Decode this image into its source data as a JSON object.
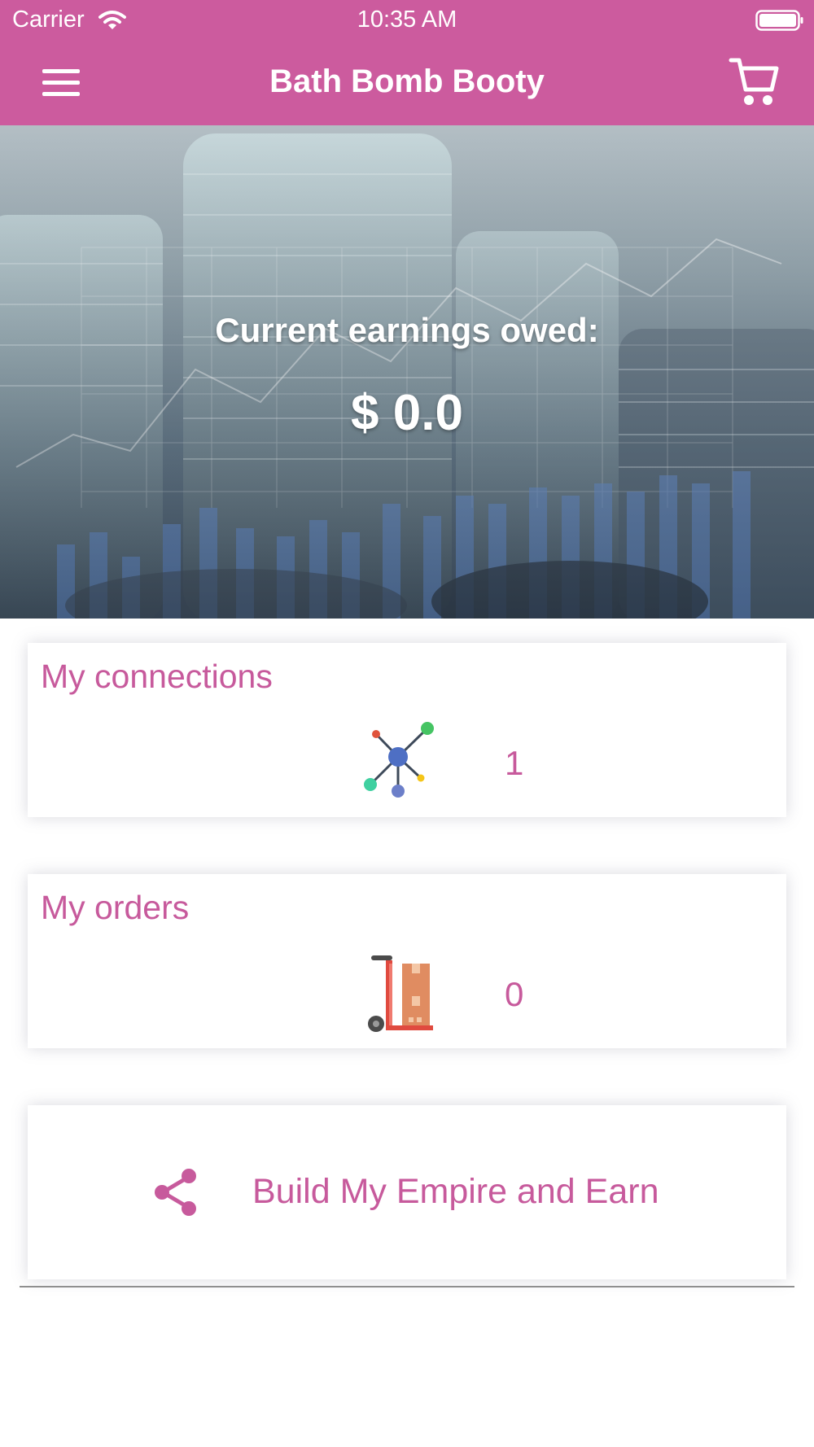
{
  "status_bar": {
    "carrier": "Carrier",
    "time": "10:35 AM"
  },
  "nav": {
    "title": "Bath Bomb Booty",
    "menu_icon": "hamburger-menu-icon",
    "cart_icon": "shopping-cart-icon"
  },
  "hero": {
    "label": "Current earnings owed:",
    "amount": "$ 0.0"
  },
  "connections": {
    "title": "My connections",
    "count": "1",
    "icon": "network-icon"
  },
  "orders": {
    "title": "My orders",
    "count": "0",
    "icon": "hand-truck-boxes-icon"
  },
  "empire": {
    "label": "Build My Empire and Earn",
    "icon": "share-icon"
  },
  "colors": {
    "brand": "#cc5b9e",
    "accent_text": "#c75a9c",
    "background": "#ffffff"
  }
}
